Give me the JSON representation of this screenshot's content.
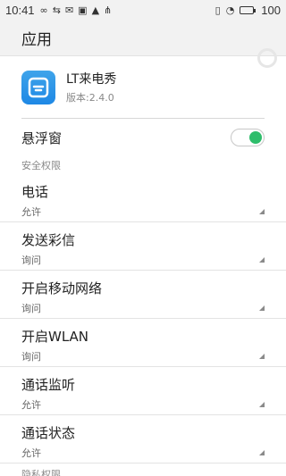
{
  "status": {
    "time": "10:41",
    "battery": "100"
  },
  "appbar": {
    "title": "应用"
  },
  "app": {
    "name": "LT来电秀",
    "version": "版本:2.4.0"
  },
  "floating_window": {
    "label": "悬浮窗",
    "enabled": true,
    "accent": "#2ebd6b"
  },
  "sections": {
    "security": "安全权限",
    "privacy": "隐私权限"
  },
  "permissions": [
    {
      "title": "电话",
      "value": "允许"
    },
    {
      "title": "发送彩信",
      "value": "询问"
    },
    {
      "title": "开启移动网络",
      "value": "询问"
    },
    {
      "title": "开启WLAN",
      "value": "询问"
    },
    {
      "title": "通话监听",
      "value": "允许"
    },
    {
      "title": "通话状态",
      "value": "允许"
    }
  ]
}
